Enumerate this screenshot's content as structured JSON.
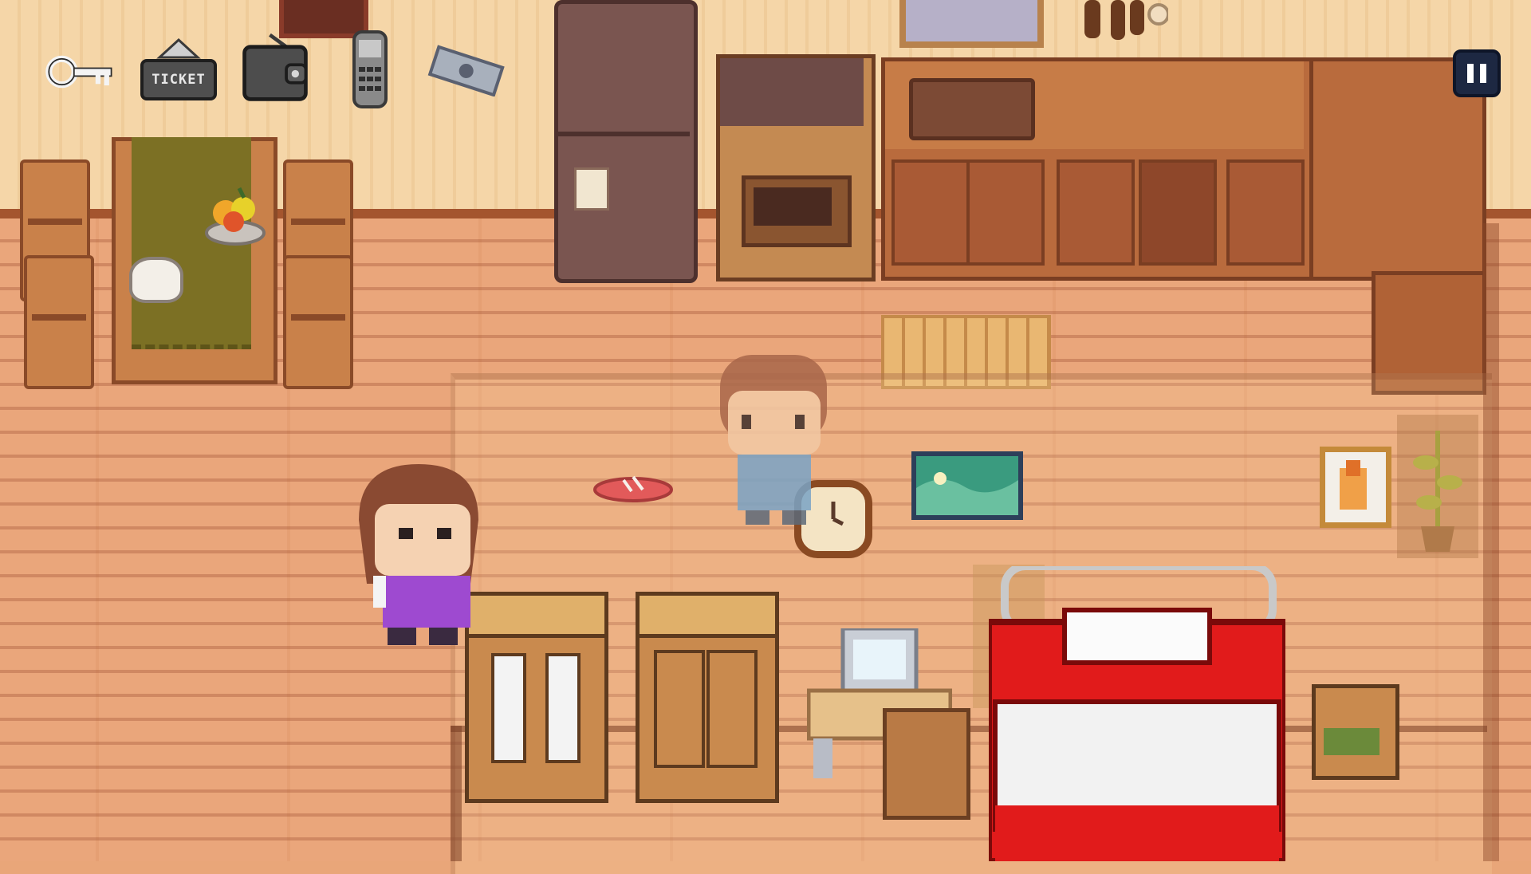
{
  "hud": {
    "inventory": [
      {
        "id": "key",
        "icon": "key-icon"
      },
      {
        "id": "ticket",
        "icon": "ticket-icon",
        "text": "TICKET"
      },
      {
        "id": "wallet",
        "icon": "wallet-icon"
      },
      {
        "id": "phone",
        "icon": "phone-icon"
      },
      {
        "id": "cash",
        "icon": "cash-icon"
      }
    ],
    "pause": {
      "icon": "pause-icon"
    }
  },
  "colors": {
    "wall": "#f5d6a8",
    "floor": "#eaa67b",
    "baseboard": "#a4552e",
    "tablecloth": "#7c7024",
    "bed_red": "#e11b1b",
    "hud_button": "#1d2842"
  },
  "scene": {
    "objects": [
      "dining-table",
      "chairs",
      "fridge",
      "stove",
      "kitchen-counter",
      "doormat",
      "wardrobes",
      "vanity",
      "bed",
      "nightstand",
      "wall-clock",
      "painting",
      "picture-frame",
      "potted-plant",
      "sandals"
    ],
    "characters": [
      "player-girl",
      "ghost-boy"
    ]
  }
}
